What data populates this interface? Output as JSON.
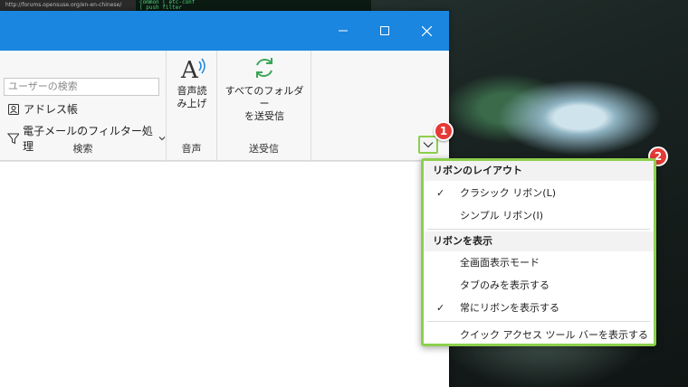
{
  "desktop": {
    "browser_url": "http://forums.opensuse.org/en-en-chinese/",
    "terminal_lines": [
      "common  [         etc-conf",
      "        [         push filter"
    ]
  },
  "ribbon": {
    "search_group": {
      "search_placeholder": "ユーザーの検索",
      "address_book_label": "アドレス帳",
      "filter_email_label": "電子メールのフィルター処理",
      "group_label": "検索"
    },
    "voice_group": {
      "read_aloud_label_1": "音声読",
      "read_aloud_label_2": "み上げ",
      "group_label": "音声"
    },
    "sendrecv_group": {
      "sendrecv_label_1": "すべてのフォルダー",
      "sendrecv_label_2": "を送受信",
      "group_label": "送受信"
    }
  },
  "badges": {
    "one": "1",
    "two": "2"
  },
  "menu": {
    "layout_heading": "リボンのレイアウト",
    "classic_ribbon": "クラシック リボン(L)",
    "simple_ribbon": "シンプル リボン(I)",
    "show_heading": "リボンを表示",
    "fullscreen_mode": "全画面表示モード",
    "show_tabs_only": "タブのみを表示する",
    "always_show_ribbon": "常にリボンを表示する",
    "show_qat": "クイック アクセス ツール バーを表示する (S)",
    "check_mark": "✓"
  },
  "colors": {
    "titlebar": "#1a86e0",
    "highlight": "#8ccf4d",
    "badge": "#e53935"
  }
}
